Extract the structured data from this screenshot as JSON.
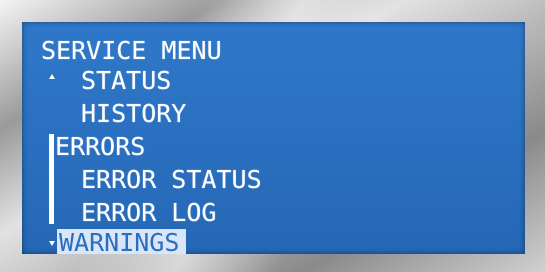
{
  "menu": {
    "title": "SERVICE MENU",
    "items": [
      {
        "label": "STATUS"
      },
      {
        "label": "HISTORY"
      },
      {
        "label": "ERRORS"
      },
      {
        "label": "ERROR STATUS"
      },
      {
        "label": "ERROR LOG"
      },
      {
        "label": "WARNINGS"
      }
    ],
    "selected_index": 5
  },
  "colors": {
    "screen_background": "#2a6fbf",
    "text": "#ffffff",
    "highlight_background": "#d9e6f7",
    "highlight_text": "#2a6fbf"
  },
  "icons": {
    "scroll_up": "scroll-up-arrow-icon",
    "scroll_down": "scroll-down-arrow-icon"
  }
}
